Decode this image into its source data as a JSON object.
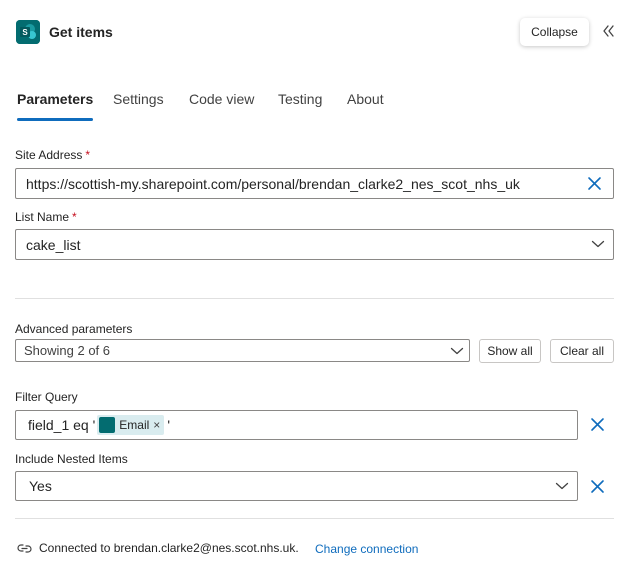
{
  "header": {
    "title": "Get items",
    "collapse_label": "Collapse"
  },
  "tabs": [
    {
      "label": "Parameters"
    },
    {
      "label": "Settings"
    },
    {
      "label": "Code view"
    },
    {
      "label": "Testing"
    },
    {
      "label": "About"
    }
  ],
  "site_address": {
    "label": "Site Address",
    "required_mark": "*",
    "value": "https://scottish-my.sharepoint.com/personal/brendan_clarke2_nes_scot_nhs_uk"
  },
  "list_name": {
    "label": "List Name",
    "required_mark": "*",
    "value": "cake_list"
  },
  "advanced": {
    "label": "Advanced parameters",
    "selected": "Showing 2 of 6",
    "show_all_label": "Show all",
    "clear_all_label": "Clear all"
  },
  "filter_query": {
    "label": "Filter Query",
    "prefix": "field_1 eq '",
    "token_label": "Email",
    "token_remove": "×",
    "suffix": "'"
  },
  "nested": {
    "label": "Include Nested Items",
    "value": "Yes"
  },
  "footer": {
    "connected_text": "Connected to brendan.clarke2@nes.scot.nhs.uk.",
    "change_link": "Change connection"
  },
  "colors": {
    "accent": "#0f6cbd",
    "sharepoint": "#036c70",
    "token_bg": "#d9ecef",
    "required": "#c50f1f"
  },
  "icons": {
    "app": "sharepoint-icon",
    "collapse": "double-chevron-left-icon",
    "clear": "close-icon",
    "dropdown": "chevron-down-icon",
    "connection": "link-icon"
  }
}
